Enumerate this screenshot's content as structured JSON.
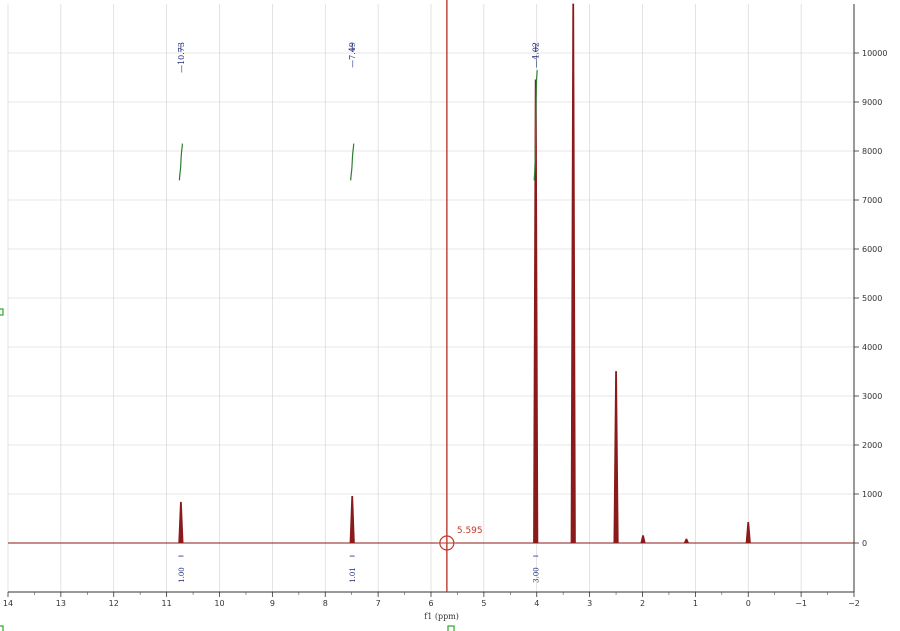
{
  "chart_data": {
    "type": "line",
    "title": "",
    "xlabel": "f1 (ppm)",
    "ylabel": "",
    "xlim": [
      14,
      -2
    ],
    "ylim": [
      -1000,
      11000
    ],
    "x_reversed": true,
    "grid": true,
    "x_ticks": [
      14,
      13,
      12,
      11,
      10,
      9,
      8,
      7,
      6,
      5,
      4,
      3,
      2,
      1,
      0,
      -1,
      -2
    ],
    "y_ticks": [
      0,
      1000,
      2000,
      3000,
      4000,
      5000,
      6000,
      7000,
      8000,
      9000,
      10000
    ],
    "peaks": [
      {
        "x": 10.73,
        "y": 830
      },
      {
        "x": 7.49,
        "y": 950
      },
      {
        "x": 4.02,
        "y": 9450
      },
      {
        "x": 3.31,
        "y": 11000
      },
      {
        "x": 2.5,
        "y": 3500
      },
      {
        "x": 1.99,
        "y": 150
      },
      {
        "x": 1.17,
        "y": 80
      },
      {
        "x": 0.0,
        "y": 420
      }
    ],
    "peak_labels": [
      {
        "x": 10.73,
        "text": "10.73"
      },
      {
        "x": 7.49,
        "text": "7.49"
      },
      {
        "x": 4.02,
        "text": "4.02"
      }
    ],
    "integrals": [
      {
        "x": 10.73,
        "value": "1.00",
        "curve_bottom": 7400,
        "curve_top": 8150
      },
      {
        "x": 7.49,
        "value": "1.01",
        "curve_bottom": 7400,
        "curve_top": 8150
      },
      {
        "x": 4.02,
        "value": "3.00",
        "curve_bottom": 7400,
        "curve_top": 9650
      }
    ],
    "cursor": {
      "x": 5.7,
      "y": 0,
      "readout": "5.595"
    },
    "colors": {
      "spectrum": "#8b1a1a",
      "integral": "#2e7d32",
      "label": "#1c2a78",
      "cursor": "#c0392b",
      "grid": "#d0d0d0"
    }
  }
}
